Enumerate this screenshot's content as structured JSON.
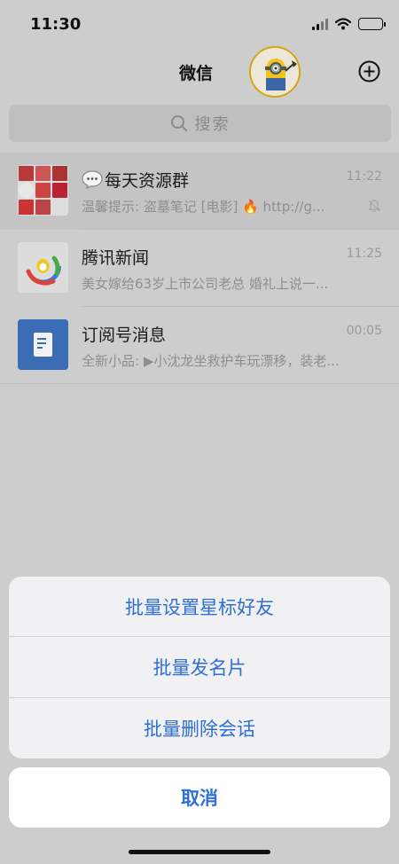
{
  "status_bar": {
    "time": "11:30"
  },
  "nav": {
    "title": "微信",
    "add_icon": "plus-circle-icon"
  },
  "search": {
    "placeholder": "搜索",
    "icon": "search-icon"
  },
  "chats": [
    {
      "name": "每天资源群",
      "name_prefix_icon": "chat-bubble-icon",
      "time": "11:22",
      "preview": "温馨提示: 盗墓笔记 [电影] 🔥 http://g...",
      "muted": true
    },
    {
      "name": "腾讯新闻",
      "time": "11:25",
      "preview": "美女嫁给63岁上市公司老总 婚礼上说一...",
      "muted": false
    },
    {
      "name": "订阅号消息",
      "time": "00:05",
      "preview": "全新小品: ▶小沈龙坐救护车玩漂移，装老...",
      "muted": false
    }
  ],
  "action_sheet": {
    "items": [
      "批量设置星标好友",
      "批量发名片",
      "批量删除会话"
    ],
    "cancel": "取消"
  },
  "colors": {
    "accent": "#2f6fd6",
    "overlay_bg": "#cdcdcd"
  }
}
